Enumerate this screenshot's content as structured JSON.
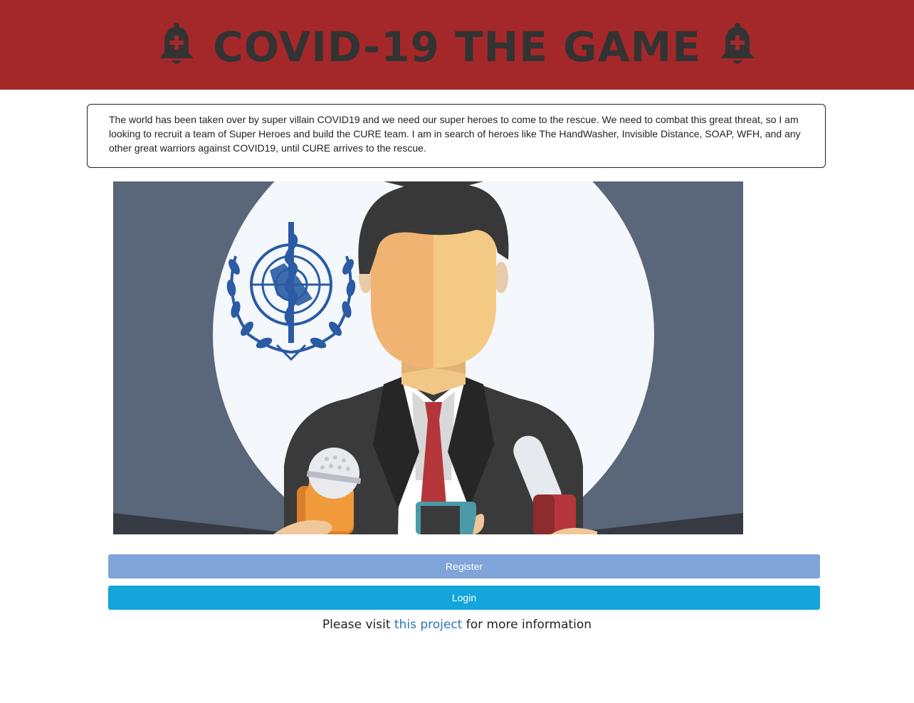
{
  "header": {
    "title": "COVID-19 THE GAME",
    "left_icon": "bell-plus-icon",
    "right_icon": "bell-plus-icon",
    "background_color": "#a4282a"
  },
  "intro": {
    "text": "The world has been taken over by super villain COVID19 and we need our super heroes to come to the rescue. We need to combat this great threat, so I am looking to recruit a team of Super Heroes and build the CURE team. I am in search of heroes like The HandWasher, Invisible Distance, SOAP, WFH, and any other great warriors against COVID19, until CURE arrives to the rescue."
  },
  "hero_image": {
    "description_icon": "press-conference-illustration"
  },
  "buttons": {
    "register_label": "Register",
    "login_label": "Login",
    "register_color": "#80a4d8",
    "login_color": "#13a5dc"
  },
  "footer": {
    "prefix": "Please visit",
    "link_text": "this project",
    "suffix": "for more information"
  }
}
